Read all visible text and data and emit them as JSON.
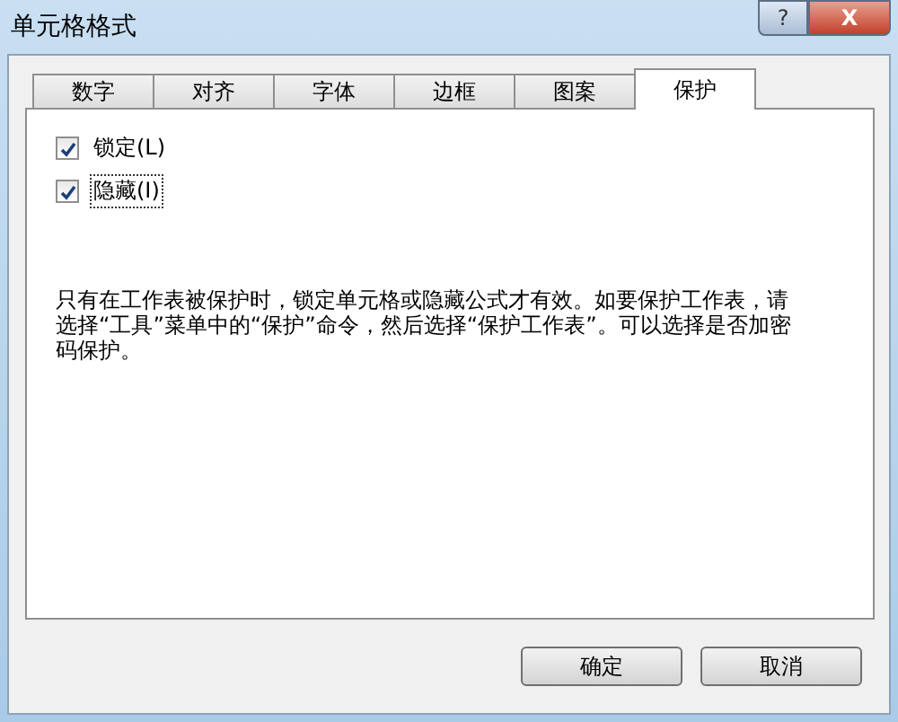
{
  "window": {
    "title": "单元格格式",
    "help_button": "?",
    "close_button": "X"
  },
  "tabs": [
    {
      "label": "数字",
      "selected": false
    },
    {
      "label": "对齐",
      "selected": false
    },
    {
      "label": "字体",
      "selected": false
    },
    {
      "label": "边框",
      "selected": false
    },
    {
      "label": "图案",
      "selected": false
    },
    {
      "label": "保护",
      "selected": true
    }
  ],
  "checkboxes": [
    {
      "label": "锁定(L)",
      "checked": true,
      "focused": false
    },
    {
      "label": "隐藏(I)",
      "checked": true,
      "focused": true
    }
  ],
  "description": "只有在工作表被保护时，锁定单元格或隐藏公式才有效。如要保护工作表，请选择“工具”菜单中的“保护”命令，然后选择“保护工作表”。可以选择是否加密码保护。",
  "buttons": [
    {
      "label": "确定"
    },
    {
      "label": "取消"
    }
  ]
}
